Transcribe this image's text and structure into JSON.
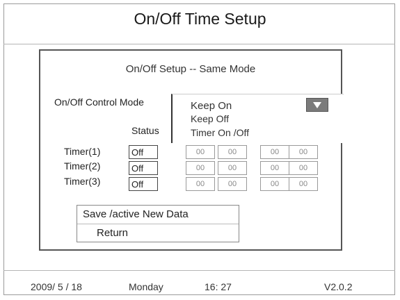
{
  "title": "On/Off  Time Setup",
  "panel": {
    "title": "On/Off Setup -- Same Mode",
    "mode_label": "On/Off Control Mode",
    "status_label": "Status",
    "dropdown": {
      "selected": "Keep On",
      "options": [
        "Keep Off",
        "Timer On /Off"
      ]
    },
    "timers": [
      {
        "label": "Timer(1)",
        "status": "Off",
        "values": [
          "00",
          "00",
          "00",
          "00"
        ]
      },
      {
        "label": "Timer(2)",
        "status": "Off",
        "values": [
          "00",
          "00",
          "00",
          "00"
        ]
      },
      {
        "label": "Timer(3)",
        "status": "Off",
        "values": [
          "00",
          "00",
          "00",
          "00"
        ]
      }
    ],
    "actions": {
      "save": "Save /active New Data",
      "return": "Return"
    }
  },
  "footer": {
    "date": "2009/ 5 / 18",
    "weekday": "Monday",
    "time": "16:  27",
    "version": "V2.0.2"
  },
  "icons": {
    "dropdown_arrow": "triangle-down-icon"
  }
}
